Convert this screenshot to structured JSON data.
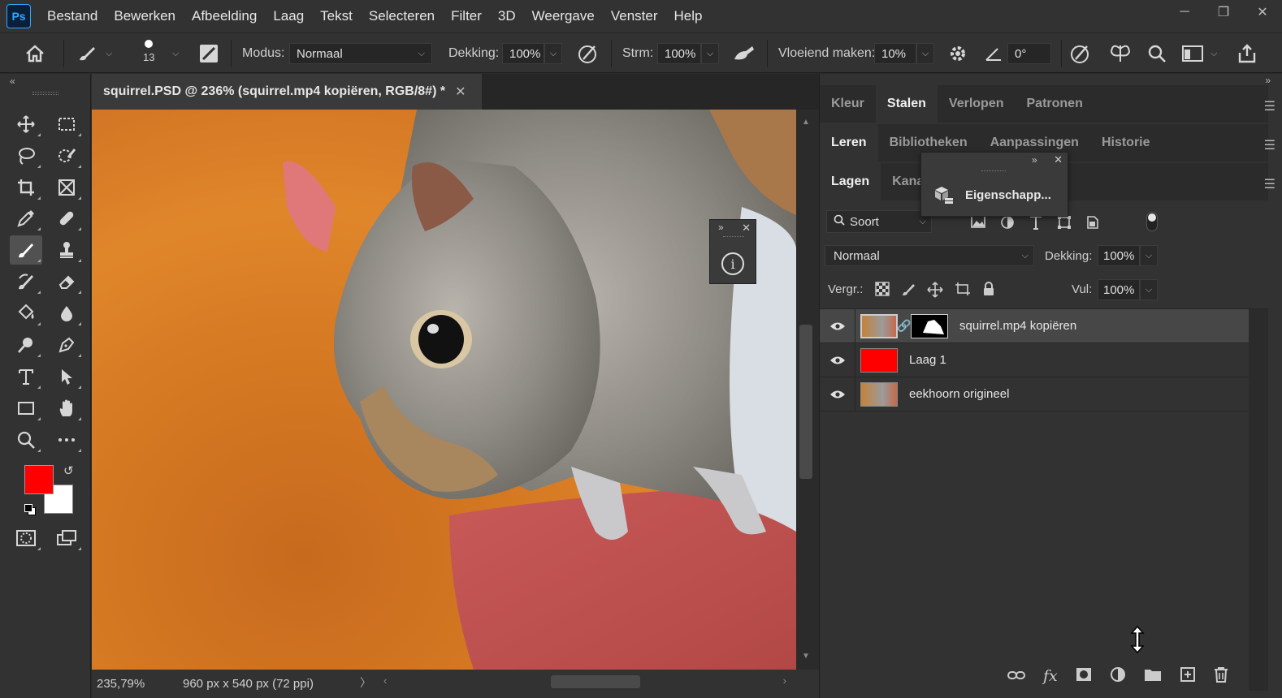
{
  "app": {
    "logo": "Ps"
  },
  "menu": [
    "Bestand",
    "Bewerken",
    "Afbeelding",
    "Laag",
    "Tekst",
    "Selecteren",
    "Filter",
    "3D",
    "Weergave",
    "Venster",
    "Help"
  ],
  "window_controls": {
    "minimize": "─",
    "maximize": "❐",
    "close": "✕"
  },
  "options": {
    "brush_size": "13",
    "modus_label": "Modus:",
    "modus_value": "Normaal",
    "dekking_label": "Dekking:",
    "dekking_value": "100%",
    "strm_label": "Strm:",
    "strm_value": "100%",
    "vloeiend_label": "Vloeiend maken:",
    "vloeiend_value": "10%",
    "angle_value": "0°"
  },
  "document": {
    "tab_title": "squirrel.PSD @ 236% (squirrel.mp4 kopiëren, RGB/8#) *",
    "zoom": "235,79%",
    "size": "960 px x 540 px (72 ppi)"
  },
  "colors": {
    "foreground": "#ff0000",
    "background": "#ffffff"
  },
  "panels": {
    "row1": [
      "Kleur",
      "Stalen",
      "Verlopen",
      "Patronen"
    ],
    "row1_active": "Stalen",
    "row2": [
      "Leren",
      "Bibliotheken",
      "Aanpassingen",
      "Historie"
    ],
    "row2_active": "Leren",
    "row3": [
      "Lagen",
      "Kanalen"
    ],
    "row3_visible": [
      "Lagen",
      "Kanal"
    ],
    "floating_label": "Eigenschapp..."
  },
  "layers_panel": {
    "filter_label": "Soort",
    "blend_mode": "Normaal",
    "dekking_label": "Dekking:",
    "dekking_value": "100%",
    "lock_label": "Vergr.:",
    "fill_label": "Vul:",
    "fill_value": "100%",
    "layers": [
      {
        "name": "squirrel.mp4 kopiëren",
        "selected": true,
        "has_mask": true
      },
      {
        "name": "Laag 1",
        "selected": false,
        "thumb_color": "#ff0000"
      },
      {
        "name": "eekhoorn origineel",
        "selected": false
      }
    ]
  }
}
